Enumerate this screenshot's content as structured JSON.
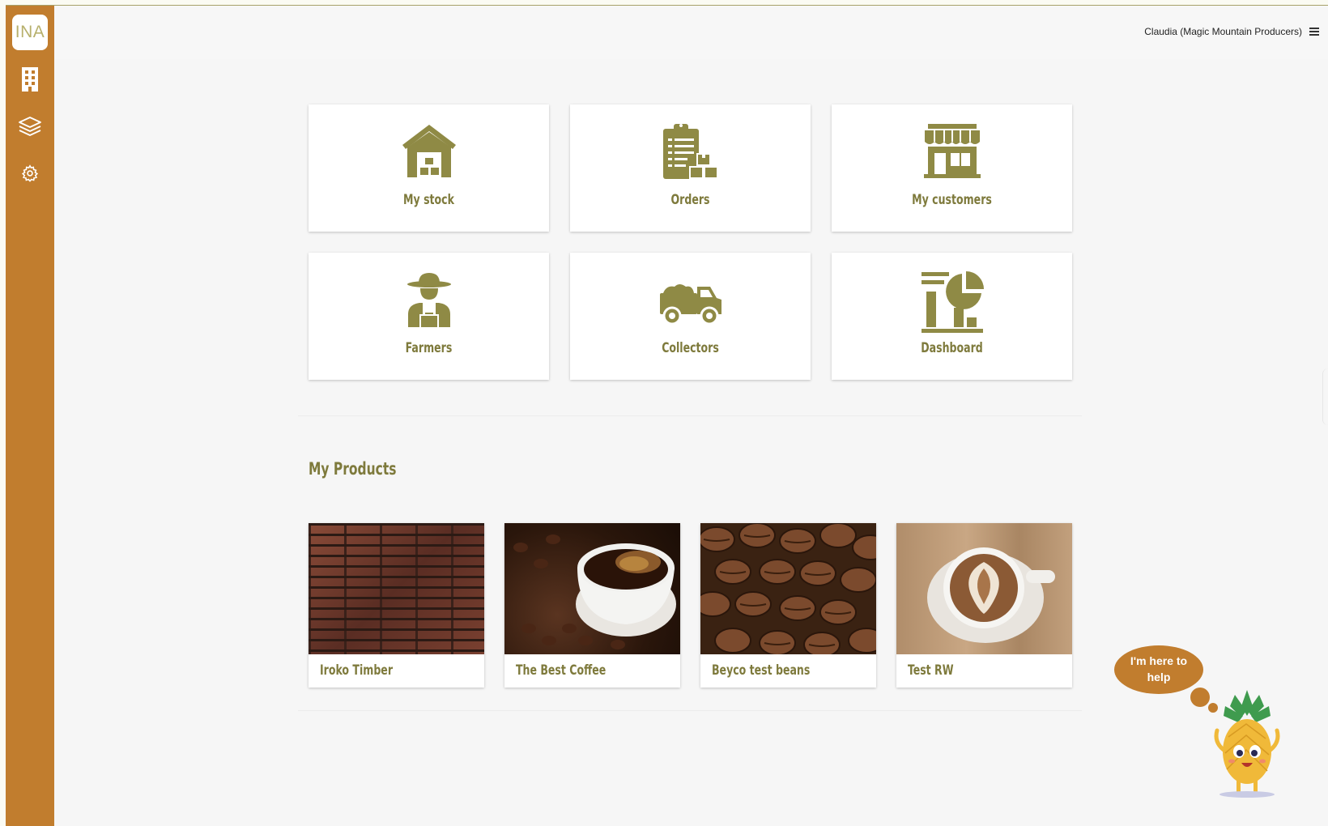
{
  "sidebar": {
    "logo_text": "INA",
    "items": [
      {
        "icon": "building-icon"
      },
      {
        "icon": "layers-icon"
      },
      {
        "icon": "gear-icon"
      }
    ]
  },
  "header": {
    "user_label": "Claudia (Magic Mountain Producers)",
    "menu_icon": "hamburger-menu-icon"
  },
  "tiles": [
    {
      "label": "My stock",
      "icon": "warehouse-icon"
    },
    {
      "label": "Orders",
      "icon": "clipboard-boxes-icon"
    },
    {
      "label": "My customers",
      "icon": "storefront-icon"
    },
    {
      "label": "Farmers",
      "icon": "farmer-icon"
    },
    {
      "label": "Collectors",
      "icon": "pickup-truck-icon"
    },
    {
      "label": "Dashboard",
      "icon": "dashboard-chart-icon"
    }
  ],
  "products_section": {
    "title": "My Products",
    "items": [
      {
        "name": "Iroko Timber",
        "image": "brick-wall-photo"
      },
      {
        "name": "The Best Coffee",
        "image": "coffee-cup-beans-photo"
      },
      {
        "name": "Beyco test beans",
        "image": "coffee-beans-photo"
      },
      {
        "name": "Test RW",
        "image": "latte-art-photo"
      }
    ]
  },
  "help": {
    "bubble_text": "I'm here to help",
    "mascot": "pineapple-mascot-icon"
  },
  "colors": {
    "sidebar": "#c17d2e",
    "accent_olive": "#8f8a45",
    "label_olive": "#7e7a3c",
    "background": "#f6f6f6"
  }
}
